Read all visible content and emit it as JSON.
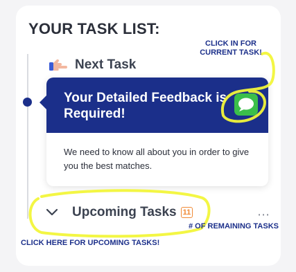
{
  "card": {
    "title": "YOUR TASK LIST:"
  },
  "next_task": {
    "label": "Next Task",
    "icon": "pointing-hand-icon",
    "heading": "Your Detailed Feedback is Required!",
    "heading_icon": "message-icon",
    "description": "We need to know all about you in order to give you the best matches.",
    "accent_color": "#1b2f8a"
  },
  "upcoming": {
    "label": "Upcoming Tasks",
    "count": "11",
    "more": "⋯",
    "badge_color": "#f08a35"
  },
  "annotations": {
    "current_task": "CLICK IN FOR CURRENT TASK!",
    "remaining": "# OF REMAINING TASKS",
    "upcoming": "CLICK HERE FOR UPCOMING TASKS!",
    "highlight_color": "#f2f53a"
  }
}
